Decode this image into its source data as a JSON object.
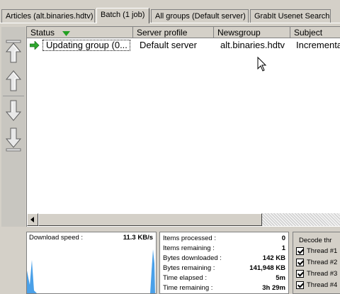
{
  "tabs": [
    {
      "label": "Articles (alt.binaries.hdtv)"
    },
    {
      "label": "Batch (1 job)"
    },
    {
      "label": "All groups (Default server)"
    },
    {
      "label": "GrabIt Usenet Search"
    }
  ],
  "toolbar": {
    "icons": [
      "move-top-icon",
      "move-up-icon",
      "move-down-icon",
      "move-bottom-icon"
    ]
  },
  "table": {
    "columns": [
      "Status",
      "Server profile",
      "Newsgroup",
      "Subject"
    ],
    "sort_column": "Status",
    "rows": [
      {
        "status": "Updating group (0...",
        "server": "Default server",
        "newsgroup": "alt.binaries.hdtv",
        "subject": "Incremental"
      }
    ]
  },
  "speed": {
    "label": "Download speed :",
    "value": "11.3 KB/s"
  },
  "stats": [
    {
      "label": "Items processed :",
      "value": "0"
    },
    {
      "label": "Items remaining :",
      "value": "1"
    },
    {
      "label": "Bytes downloaded :",
      "value": "142 KB"
    },
    {
      "label": "Bytes remaining :",
      "value": "141,948 KB"
    },
    {
      "label": "Time elapsed :",
      "value": "5m"
    },
    {
      "label": "Time remaining :",
      "value": "3h 29m"
    }
  ],
  "decode": {
    "title": "Decode thr",
    "threads": [
      "Thread #1",
      "Thread #2",
      "Thread #3",
      "Thread #4"
    ]
  },
  "colors": {
    "play_arrow": "#2ea82e",
    "graph": "#4aa0e8"
  }
}
